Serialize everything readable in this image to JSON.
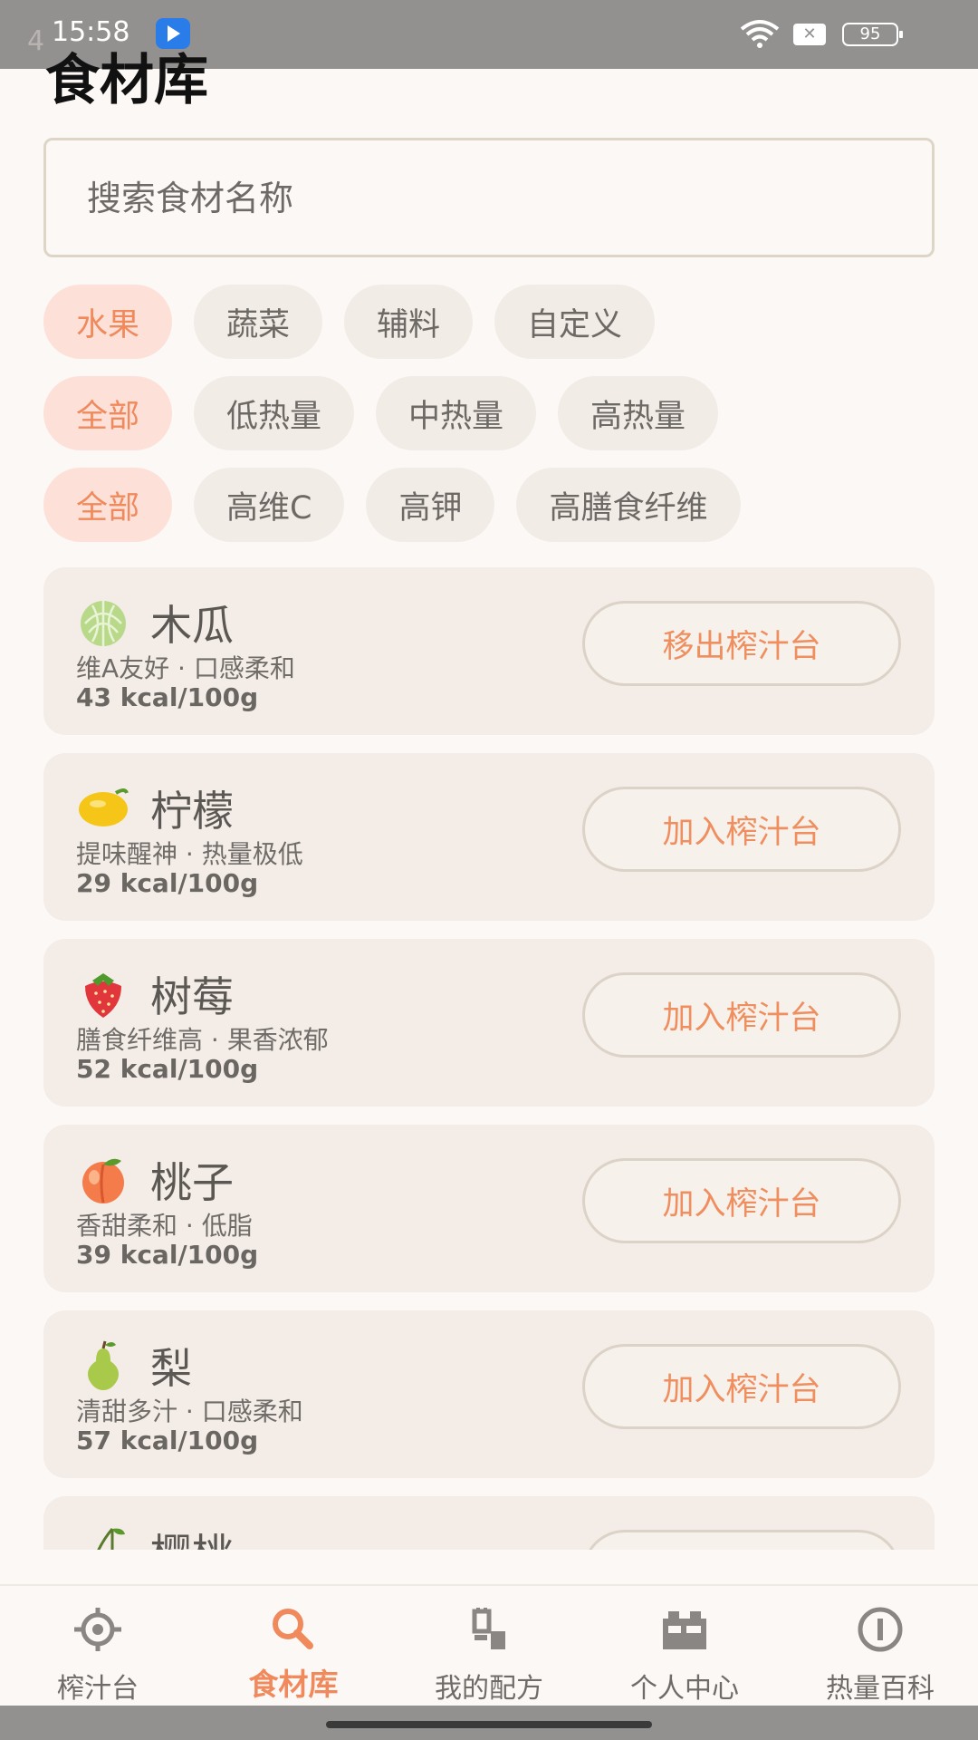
{
  "status_bar": {
    "time": "15:58",
    "ghost_text": "4",
    "battery": "95",
    "sim": "✕"
  },
  "header": {
    "title": "食材库"
  },
  "search": {
    "placeholder": "搜索食材名称",
    "value": ""
  },
  "filters": {
    "category": [
      "水果",
      "蔬菜",
      "辅料",
      "自定义"
    ],
    "category_active": "水果",
    "calorie": [
      "全部",
      "低热量",
      "中热量",
      "高热量"
    ],
    "calorie_active": "全部",
    "nutrient": [
      "全部",
      "高维C",
      "高钾",
      "高膳食纤维"
    ],
    "nutrient_active": "全部"
  },
  "foods": [
    {
      "emoji": "melon",
      "name": "木瓜",
      "desc": "维A友好 · 口感柔和",
      "kcal": "43 kcal/100g",
      "action": "移出榨汁台"
    },
    {
      "emoji": "lemon",
      "name": "柠檬",
      "desc": "提味醒神 · 热量极低",
      "kcal": "29 kcal/100g",
      "action": "加入榨汁台"
    },
    {
      "emoji": "strawberry",
      "name": "树莓",
      "desc": "膳食纤维高 · 果香浓郁",
      "kcal": "52 kcal/100g",
      "action": "加入榨汁台"
    },
    {
      "emoji": "peach",
      "name": "桃子",
      "desc": "香甜柔和 · 低脂",
      "kcal": "39 kcal/100g",
      "action": "加入榨汁台"
    },
    {
      "emoji": "pear",
      "name": "梨",
      "desc": "清甜多汁 · 口感柔和",
      "kcal": "57 kcal/100g",
      "action": "加入榨汁台"
    },
    {
      "emoji": "cherries",
      "name": "樱桃",
      "desc": "",
      "kcal": "",
      "action": ""
    }
  ],
  "nav": {
    "items": [
      {
        "label": "榨汁台",
        "icon": "target-icon"
      },
      {
        "label": "食材库",
        "icon": "search-icon"
      },
      {
        "label": "我的配方",
        "icon": "recipe-icon"
      },
      {
        "label": "个人中心",
        "icon": "person-icon"
      },
      {
        "label": "热量百科",
        "icon": "info-icon"
      }
    ],
    "active": "食材库"
  },
  "colors": {
    "accent": "#f08a5d",
    "background": "#fcf8f5",
    "card": "#f4ede7",
    "chip_active_bg": "#fde1d8"
  }
}
